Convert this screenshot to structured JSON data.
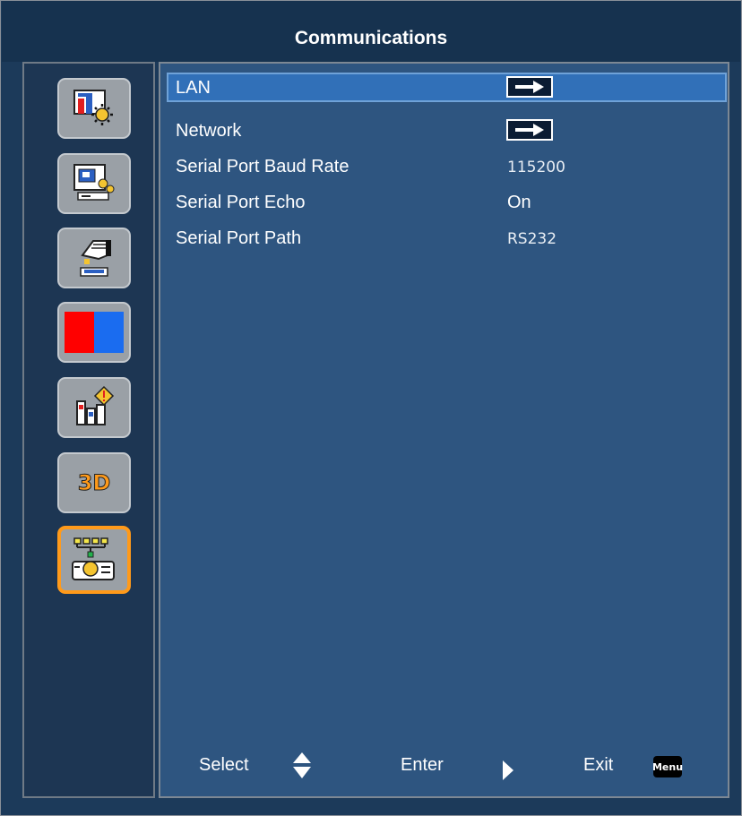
{
  "header": {
    "title": "Communications"
  },
  "sidebar": {
    "items": [
      {
        "icon": "picture-settings-icon",
        "selected": false
      },
      {
        "icon": "screen-setup-icon",
        "selected": false
      },
      {
        "icon": "projector-settings-icon",
        "selected": false
      },
      {
        "icon": "color-split-icon",
        "selected": false
      },
      {
        "icon": "information-icon",
        "selected": false
      },
      {
        "icon": "3d-icon",
        "label": "3D",
        "selected": false
      },
      {
        "icon": "network-communications-icon",
        "selected": true
      }
    ]
  },
  "menu": {
    "items": [
      {
        "label": "LAN",
        "value_type": "submenu-arrow",
        "highlighted": true
      },
      {
        "label": "Network",
        "value_type": "submenu-arrow",
        "highlighted": false
      },
      {
        "label": "Serial Port Baud Rate",
        "value": "115200"
      },
      {
        "label": "Serial Port Echo",
        "value": "On"
      },
      {
        "label": "Serial Port Path",
        "value": "RS232"
      }
    ]
  },
  "footer": {
    "select_label": "Select",
    "enter_label": "Enter",
    "exit_label": "Exit",
    "menu_key_label": "Menu"
  },
  "colors": {
    "background": "#1c3a5a",
    "panel": "#2e5580",
    "highlight": "#3170b8",
    "selected_border": "#ff9a1a",
    "text": "#ffffff"
  }
}
